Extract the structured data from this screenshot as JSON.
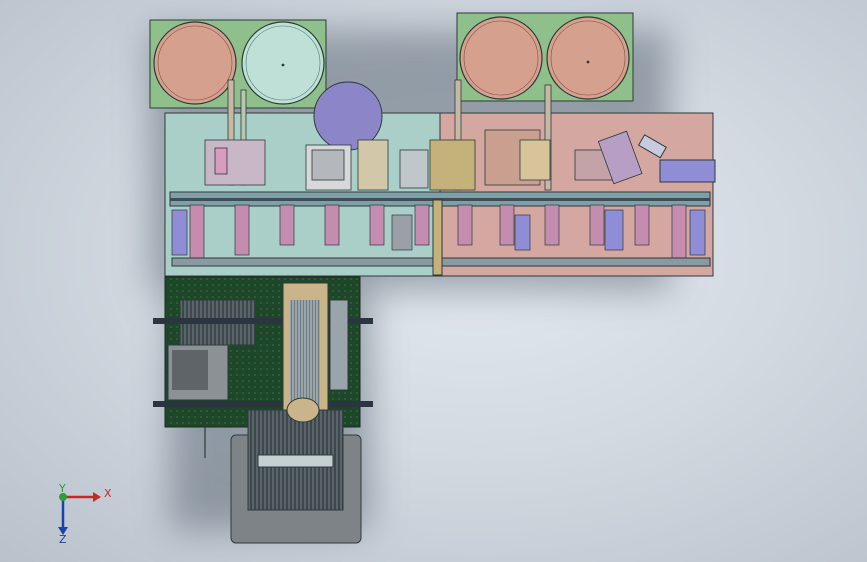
{
  "window": {
    "type": "3d-cad-viewport"
  },
  "model": {
    "name": "",
    "colors": {
      "base_plate_left": "#a9cfc8",
      "base_plate_right": "#d4a7a0",
      "reel_green_frame": "#8fbf8a",
      "reel_pink": "#d6a08f",
      "reel_cyan": "#bfe0d6",
      "purple_disc": "#8c86c9",
      "pcb_green": "#1f4a2a",
      "rail_gray": "#8a9aa2",
      "lower_stage_gray": "#7e8388",
      "roller_pink": "#c98aa6",
      "column_blue": "#8e8dd6"
    }
  },
  "triad": {
    "x_label": "X",
    "y_label": "Y",
    "z_label": "Z",
    "x_color": "#c62828",
    "y_color": "#2e9d3a",
    "z_color": "#1e3fae"
  }
}
